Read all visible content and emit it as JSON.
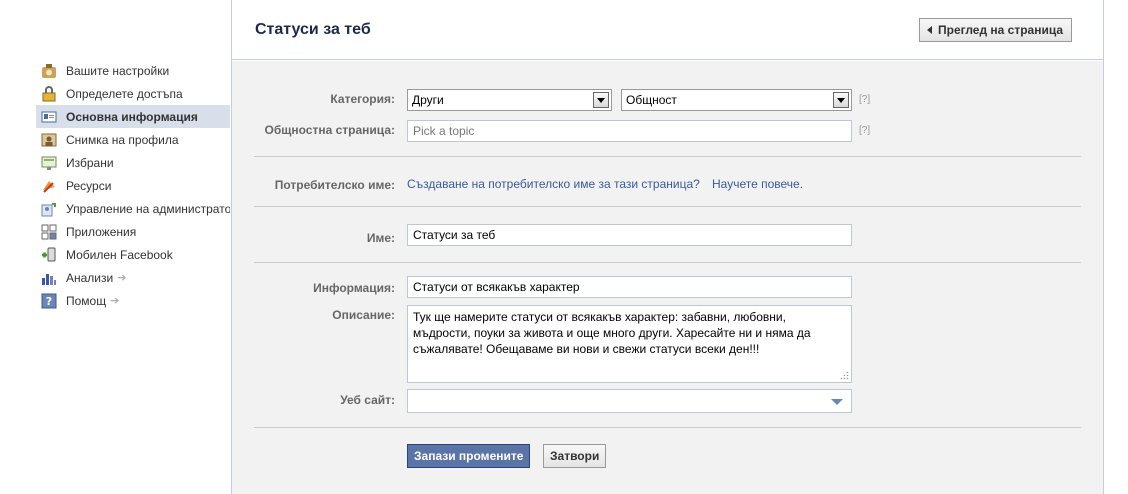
{
  "sidebar": {
    "items": [
      {
        "label": "Вашите настройки",
        "icon": "settings-icon"
      },
      {
        "label": "Определете достъпа",
        "icon": "lock-icon"
      },
      {
        "label": "Основна информация",
        "icon": "info-card-icon",
        "active": true
      },
      {
        "label": "Снимка на профила",
        "icon": "profile-picture-icon"
      },
      {
        "label": "Избрани",
        "icon": "featured-icon"
      },
      {
        "label": "Ресурси",
        "icon": "resources-icon"
      },
      {
        "label": "Управление на администраторите",
        "icon": "admins-icon"
      },
      {
        "label": "Приложения",
        "icon": "apps-icon"
      },
      {
        "label": "Мобилен Facebook",
        "icon": "mobile-icon"
      },
      {
        "label": "Анализи",
        "icon": "insights-icon",
        "arrow": true
      },
      {
        "label": "Помощ",
        "icon": "help-icon",
        "arrow": true
      }
    ]
  },
  "header": {
    "title": "Статуси за теб",
    "view_page_label": "Преглед на страница"
  },
  "form": {
    "category_label": "Категория:",
    "category_value": "Други",
    "subcategory_value": "Общност",
    "help_text": "[?]",
    "community_label": "Общностна страница:",
    "community_placeholder": "Pick a topic",
    "username_label": "Потребителско име:",
    "username_link": "Създаване на потребителско име за тази страница?",
    "learn_more_link": "Научете повече.",
    "name_label": "Име:",
    "name_value": "Статуси за теб",
    "info_label": "Информация:",
    "info_value": "Статуси от всякакъв характер",
    "description_label": "Описание:",
    "description_lines": [
      "Тук ще намерите статуси от всякакъв характер: забавни, любовни,",
      "мъдрости, поуки за живота и още много други. Харесайте ни и няма да",
      "съжалявате! Обещаваме ви нови и свежи статуси всеки ден!!!"
    ],
    "website_label": "Уеб сайт:",
    "website_value": ""
  },
  "actions": {
    "save_label": "Запази промените",
    "close_label": "Затвори"
  },
  "colors": {
    "link": "#3b5998",
    "active_nav": "#d8dfea",
    "save_button": "#5b74a8"
  }
}
